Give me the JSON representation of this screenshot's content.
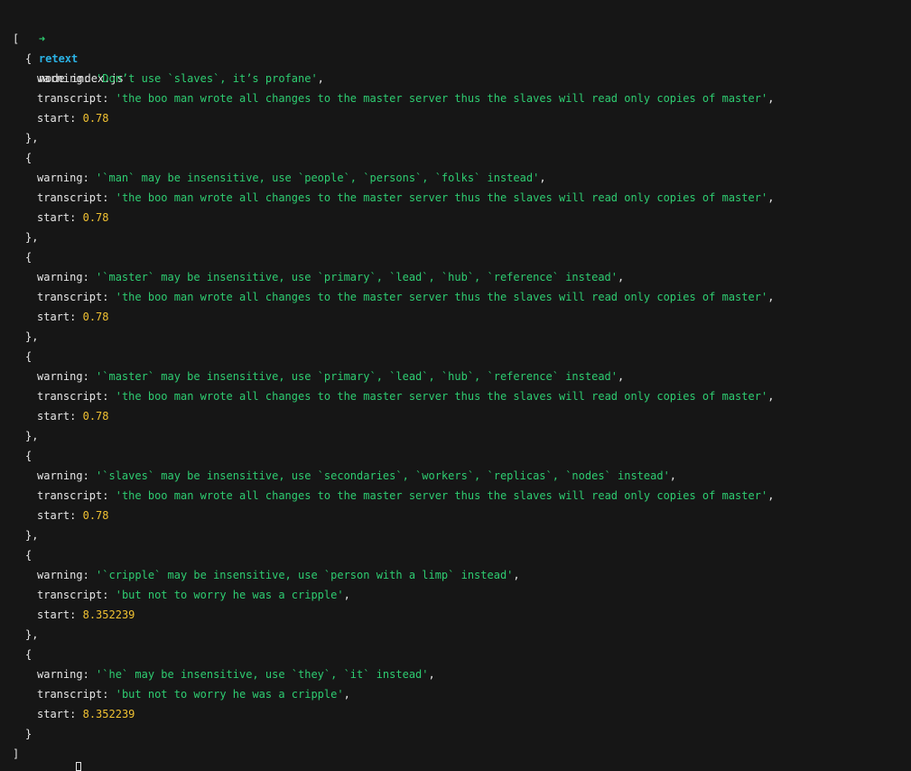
{
  "prompt": {
    "arrow": "➜",
    "directory": "retext",
    "command": "node index.js"
  },
  "output": {
    "open_bracket": "[",
    "close_bracket": "]",
    "open_brace": "{",
    "close_brace_comma": "},",
    "close_brace": "}",
    "keys": {
      "warning": "warning:",
      "transcript": "transcript:",
      "start": "start:"
    },
    "entries": [
      {
        "warning": "'Don’t use `slaves`, it’s profane'",
        "transcript": "'the boo man wrote all changes to the master server thus the slaves will read only copies of master'",
        "start": "0.78"
      },
      {
        "warning": "'`man` may be insensitive, use `people`, `persons`, `folks` instead'",
        "transcript": "'the boo man wrote all changes to the master server thus the slaves will read only copies of master'",
        "start": "0.78"
      },
      {
        "warning": "'`master` may be insensitive, use `primary`, `lead`, `hub`, `reference` instead'",
        "transcript": "'the boo man wrote all changes to the master server thus the slaves will read only copies of master'",
        "start": "0.78"
      },
      {
        "warning": "'`master` may be insensitive, use `primary`, `lead`, `hub`, `reference` instead'",
        "transcript": "'the boo man wrote all changes to the master server thus the slaves will read only copies of master'",
        "start": "0.78"
      },
      {
        "warning": "'`slaves` may be insensitive, use `secondaries`, `workers`, `replicas`, `nodes` instead'",
        "transcript": "'the boo man wrote all changes to the master server thus the slaves will read only copies of master'",
        "start": "0.78"
      },
      {
        "warning": "'`cripple` may be insensitive, use `person with a limp` instead'",
        "transcript": "'but not to worry he was a cripple'",
        "start": "8.352239"
      },
      {
        "warning": "'`he` may be insensitive, use `they`, `it` instead'",
        "transcript": "'but not to worry he was a cripple'",
        "start": "8.352239"
      }
    ]
  },
  "colors": {
    "background": "#161616",
    "text": "#e6e6e6",
    "string": "#2ecc71",
    "number": "#f1c232",
    "directory": "#2bb3e6"
  }
}
